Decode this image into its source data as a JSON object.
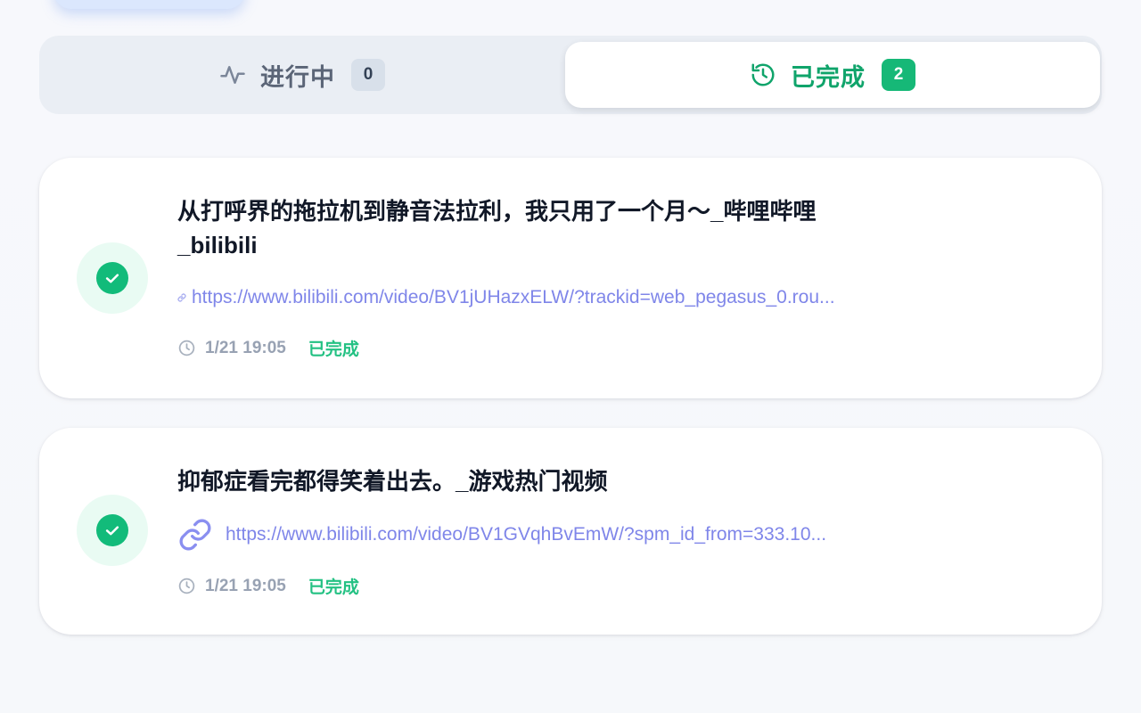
{
  "tabs": {
    "in_progress": {
      "label": "进行中",
      "count": "0",
      "icon": "activity-icon"
    },
    "completed": {
      "label": "已完成",
      "count": "2",
      "icon": "history-icon"
    }
  },
  "tasks": [
    {
      "title_line1": "从打呼界的拖拉机到静音法拉利，我只用了一个月～_哔哩哔哩",
      "title_line2": "_bilibili",
      "url": "https://www.bilibili.com/video/BV1jUHazxELW/?trackid=web_pegasus_0.rou...",
      "time": "1/21 19:05",
      "status": "已完成"
    },
    {
      "title_line1": "抑郁症看完都得笑着出去。_游戏热门视频",
      "url": "https://www.bilibili.com/video/BV1GVqhBvEmW/?spm_id_from=333.10...",
      "time": "1/21 19:05",
      "status": "已完成"
    }
  ],
  "colors": {
    "accent_green": "#10a46b",
    "link_purple": "#7f86e9",
    "muted_gray": "#98a2b3"
  }
}
